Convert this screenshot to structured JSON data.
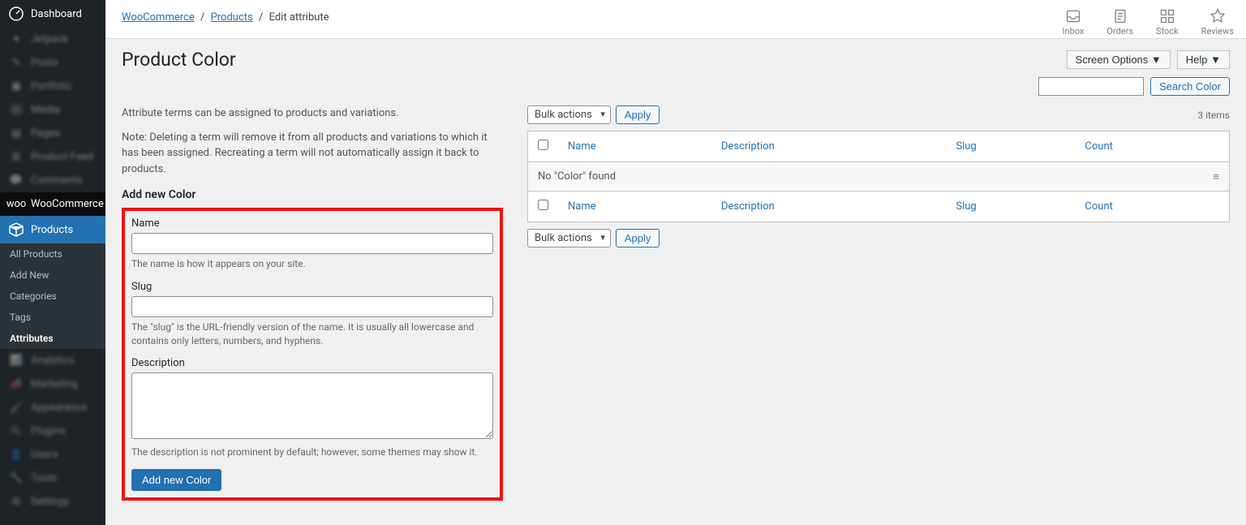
{
  "sidebar": {
    "dashboard": "Dashboard",
    "blurred_top": [
      "Jetpack",
      "Posts",
      "Portfolio",
      "Media",
      "Pages",
      "Product Feed",
      "Comments"
    ],
    "woocommerce": "WooCommerce",
    "products": "Products",
    "products_sub": [
      {
        "label": "All Products",
        "current": false
      },
      {
        "label": "Add New",
        "current": false
      },
      {
        "label": "Categories",
        "current": false
      },
      {
        "label": "Tags",
        "current": false
      },
      {
        "label": "Attributes",
        "current": true
      }
    ],
    "blurred_bottom": [
      "Analytics",
      "Marketing",
      "Appearance",
      "Plugins",
      "Users",
      "Tools",
      "Settings"
    ]
  },
  "breadcrumb": {
    "woocommerce": "WooCommerce",
    "products": "Products",
    "current": "Edit attribute"
  },
  "top_icons": [
    {
      "label": "Inbox",
      "name": "inbox-icon"
    },
    {
      "label": "Orders",
      "name": "orders-icon"
    },
    {
      "label": "Stock",
      "name": "stock-icon"
    },
    {
      "label": "Reviews",
      "name": "reviews-icon"
    }
  ],
  "page_title": "Product Color",
  "tabs": {
    "screen_options": "Screen Options",
    "help": "Help"
  },
  "search": {
    "button": "Search Color"
  },
  "intro": "Attribute terms can be assigned to products and variations.",
  "note": "Note: Deleting a term will remove it from all products and variations to which it has been assigned. Recreating a term will not automatically assign it back to products.",
  "add_section": "Add new Color",
  "form": {
    "name_label": "Name",
    "name_desc": "The name is how it appears on your site.",
    "slug_label": "Slug",
    "slug_desc": "The \"slug\" is the URL-friendly version of the name. It is usually all lowercase and contains only letters, numbers, and hyphens.",
    "desc_label": "Description",
    "desc_desc": "The description is not prominent by default; however, some themes may show it.",
    "submit": "Add new Color"
  },
  "bulk": {
    "select": "Bulk actions",
    "apply": "Apply",
    "items_count": "3 items"
  },
  "table": {
    "headers": {
      "name": "Name",
      "description": "Description",
      "slug": "Slug",
      "count": "Count"
    },
    "empty": "No \"Color\" found"
  }
}
